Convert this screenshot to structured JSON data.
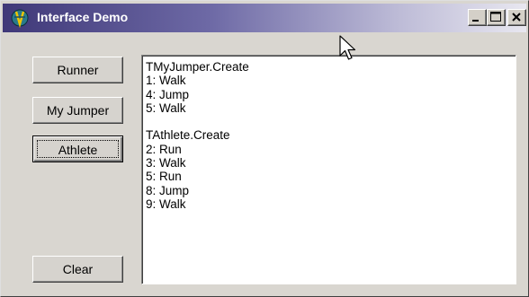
{
  "window": {
    "title": "Interface Demo",
    "icon": "delphi-app-icon",
    "controls": {
      "minimize_icon": "minimize-icon",
      "maximize_icon": "maximize-icon",
      "close_icon": "close-icon"
    }
  },
  "buttons": {
    "runner": "Runner",
    "my_jumper": "My Jumper",
    "athlete": "Athlete",
    "clear": "Clear"
  },
  "log": {
    "lines": [
      "TMyJumper.Create",
      "1: Walk",
      "4: Jump",
      "5: Walk",
      "",
      "TAthlete.Create",
      "2: Run",
      "3: Walk",
      "5: Run",
      "8: Jump",
      "9: Walk"
    ]
  },
  "colors": {
    "titlebar_start": "#3f3878",
    "titlebar_end": "#e8e7f0",
    "window_bg": "#d9d6d0",
    "memo_bg": "#ffffff"
  }
}
